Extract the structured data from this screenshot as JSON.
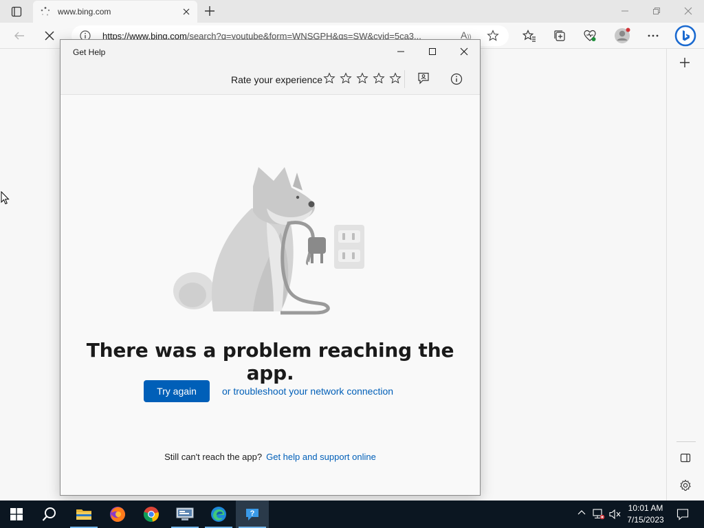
{
  "browser": {
    "tab_title": "www.bing.com",
    "url_host": "https://www.bing.com",
    "url_rest": "/search?q=youtube&form=WNSGPH&qs=SW&cvid=5ca3...",
    "read_aloud_label": "A"
  },
  "get_help": {
    "window_title": "Get Help",
    "rate_label": "Rate your experience",
    "stars": [
      "1",
      "2",
      "3",
      "4",
      "5"
    ],
    "error_title": "There was a problem reaching the app.",
    "try_again": "Try again",
    "troubleshoot": "or troubleshoot your network connection",
    "still_text": "Still can't reach the app?",
    "support_link": "Get help and support online"
  },
  "taskbar": {
    "time": "10:01 AM",
    "date": "7/15/2023"
  },
  "colors": {
    "accent": "#005fb8",
    "taskbar": "#0b1621"
  }
}
